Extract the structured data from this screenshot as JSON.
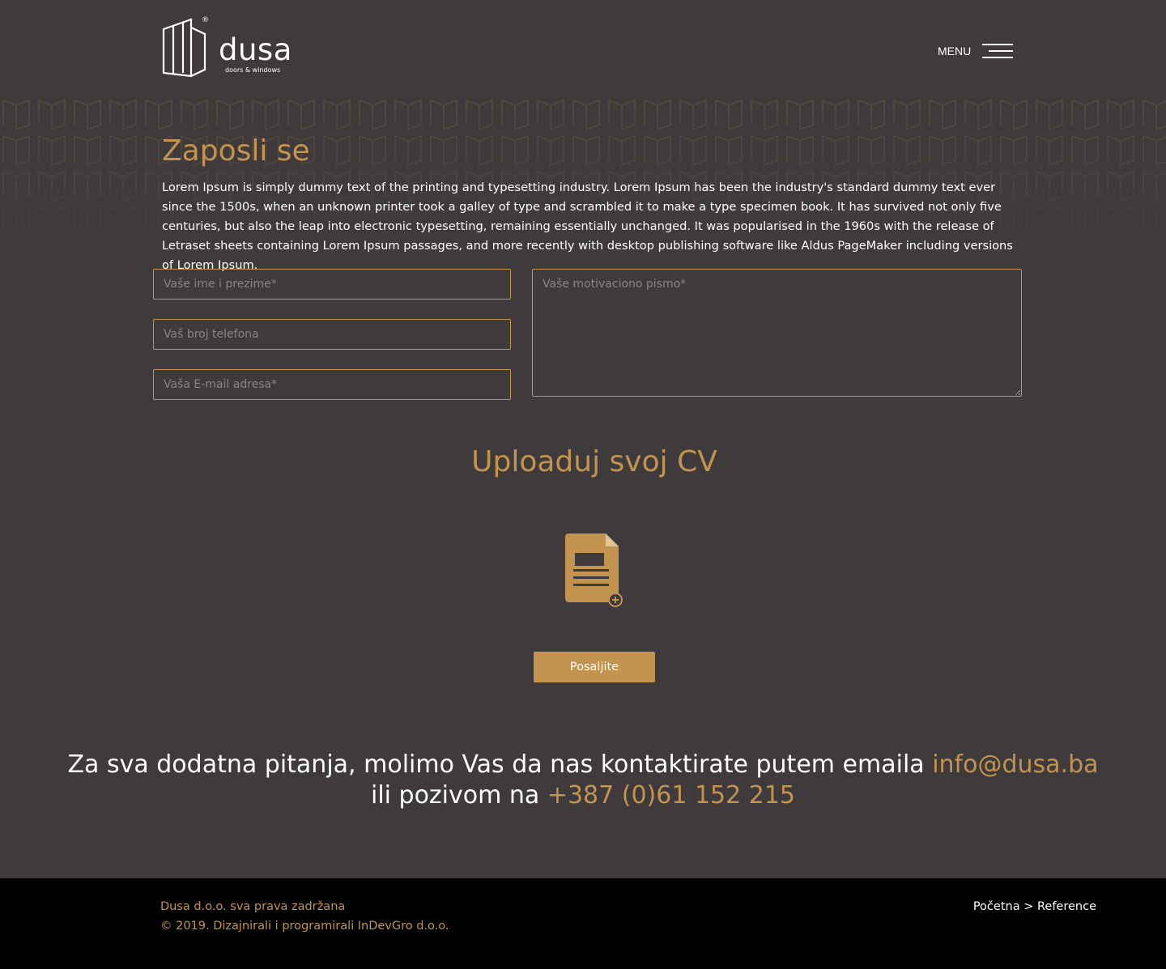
{
  "colors": {
    "background": "#3f3a3c",
    "accent": "#c39350",
    "footer": "#000000",
    "text": "#ffffff"
  },
  "header": {
    "logo": {
      "word": "dusa",
      "subtitle": "doors & windows",
      "registered": "®"
    },
    "menu_label": "MENU",
    "menu_icon": "hamburger-icon"
  },
  "main": {
    "title": "Zaposli se",
    "intro": "Lorem Ipsum is simply dummy text of the printing and typesetting industry. Lorem Ipsum has been the industry's standard dummy text ever since the 1500s, when an unknown printer took a galley of type and scrambled it to make a type specimen book. It has survived not only five centuries, but also the leap into electronic typesetting, remaining essentially unchanged. It was popularised in the 1960s with the release of Letraset sheets containing Lorem Ipsum passages, and more recently with desktop publishing software like Aldus PageMaker including versions of Lorem Ipsum."
  },
  "form": {
    "name_placeholder": "Vaše ime i prezime*",
    "phone_placeholder": "Vaš broj telefona",
    "email_placeholder": "Vaša E-mail adresa*",
    "letter_placeholder": "Vaše motivaciono pismo*",
    "name_value": "",
    "phone_value": "",
    "email_value": "",
    "letter_value": ""
  },
  "upload": {
    "title": "Uploaduj svoj CV",
    "icon": "document-add-icon",
    "submit_label": "Posaljite"
  },
  "contact": {
    "line1_text": "Za sva dodatna pitanja, molimo Vas da nas kontaktirate putem emaila ",
    "email": "info@dusa.ba",
    "line2_text": "ili pozivom na ",
    "phone": "+387 (0)61 152 215"
  },
  "footer": {
    "rights": "Dusa d.o.o. sva prava zadržana",
    "credits": "© 2019. Dizajnirali i programirali InDevGro d.o.o.",
    "breadcrumb": {
      "home": "Početna",
      "separator": ">",
      "current": "Reference"
    }
  }
}
